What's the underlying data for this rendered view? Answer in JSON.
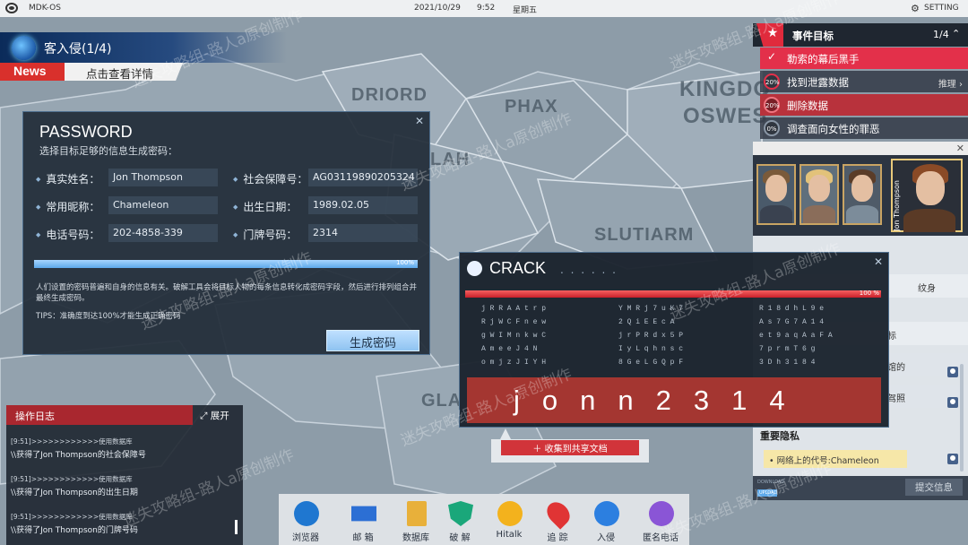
{
  "topbar": {
    "os_name": "MDK-OS",
    "date": "2021/10/29",
    "time": "9:52",
    "weekday": "星期五",
    "setting_label": "SETTING"
  },
  "map": {
    "labels": [
      "DRIORD",
      "PHAX",
      "KINGDO",
      "OSWES",
      "LAH",
      "SLUTIARM",
      "GLA"
    ]
  },
  "intrusion": {
    "title": "客入侵(1/4)",
    "news_tag": "News",
    "news_link": "点击查看详情"
  },
  "password_panel": {
    "title": "PASSWORD",
    "subtitle": "选择目标足够的信息生成密码：",
    "fields": [
      {
        "label": "真实姓名：",
        "value": "Jon Thompson"
      },
      {
        "label": "社会保障号：",
        "value": "AG03119890205324"
      },
      {
        "label": "常用昵称：",
        "value": "Chameleon"
      },
      {
        "label": "出生日期：",
        "value": "1989.02.05"
      },
      {
        "label": "电话号码：",
        "value": "202-4858-339"
      },
      {
        "label": "门牌号码：",
        "value": "2314"
      }
    ],
    "progress_percent": 100,
    "progress_label": "100%",
    "description": "人们设置的密码普遍和自身的信息有关。破解工具会将目标人物的每条信息转化成密码字段，然后进行排列组合并最终生成密码。",
    "tips": "TIPS：准确度到达100%才能生成正确密码",
    "generate_button": "生成密码"
  },
  "goals": {
    "title": "事件目标",
    "count": "1/4",
    "items": [
      {
        "text": "勒索的幕后黑手",
        "badge": "✓",
        "tip": "",
        "style": "done"
      },
      {
        "text": "找到泄露数据",
        "badge": "20%",
        "tip": "推理",
        "style": "normal"
      },
      {
        "text": "删除数据",
        "badge": "20%",
        "tip": "",
        "style": "active"
      },
      {
        "text": "调查面向女性的罪恶",
        "badge": "0%",
        "tip": "",
        "style": "normal"
      }
    ]
  },
  "character_panel": {
    "jon_name": "Jon Thompson",
    "list_snippets": [
      "纹身",
      "标",
      "馆的",
      "驾照"
    ],
    "section_title": "重要隐私",
    "alias": "网络上的代号:Chameleon",
    "download_label": "DOWNLOAD",
    "upload_label": "UPLOAD",
    "submit_button": "提交信息"
  },
  "crack_panel": {
    "title": "CRACK",
    "dots": ". . . . . .",
    "progress_percent": 100,
    "progress_label": "100 %",
    "grid": [
      [
        "j R R A A t r p",
        "Y M R j 7 u K 7",
        "R 1 8 d h L 9 e"
      ],
      [
        "R j W C F n e w",
        "2 Q i E E c A",
        "A s 7 G 7 A 1 4"
      ],
      [
        "g W I M n k w C",
        "j r P R d x 5 P",
        "e t 9 a q A a F A"
      ],
      [
        "A m e e J 4 N",
        "I y L q h n s c",
        "7 p r m T 6 g"
      ],
      [
        "o m j z J I Y H",
        "8 G e L G Q p F",
        "3 D h 3 1 8 4"
      ]
    ],
    "result_chars": [
      "j",
      "o",
      "n",
      "n",
      "2",
      "3",
      "1",
      "4"
    ]
  },
  "collect_button": "收集到共享文档",
  "log": {
    "title": "操作日志",
    "expand_label": "展开",
    "entries": [
      {
        "line": "[9:51]>>>>>>>>>>>>使用数据库",
        "detail": "\\\\获得了Jon Thompson的社会保障号"
      },
      {
        "line": "[9:51]>>>>>>>>>>>>使用数据库",
        "detail": "\\\\获得了Jon Thompson的出生日期"
      },
      {
        "line": "[9:51]>>>>>>>>>>>>使用数据库",
        "detail": "\\\\获得了Jon Thompson的门牌号码"
      }
    ]
  },
  "dock": {
    "items": [
      {
        "label": "浏览器",
        "icon": "globe-icon",
        "color": "#1f77d0"
      },
      {
        "label": "邮 箱",
        "icon": "mail-icon",
        "color": "#2c6fd4"
      },
      {
        "label": "数据库",
        "icon": "database-icon",
        "color": "#e8b03a"
      },
      {
        "label": "破 解",
        "icon": "shield-icon",
        "color": "#1aa77a"
      },
      {
        "label": "Hitalk",
        "icon": "chat-icon",
        "color": "#f3b21d"
      },
      {
        "label": "追 踪",
        "icon": "location-pin-icon",
        "color": "#e03434"
      },
      {
        "label": "入侵",
        "icon": "hook-icon",
        "color": "#2c7fe0"
      },
      {
        "label": "匿名电话",
        "icon": "phone-icon",
        "color": "#8a55d6"
      }
    ]
  },
  "watermark": "迷失攻略组-路人a原创制作"
}
